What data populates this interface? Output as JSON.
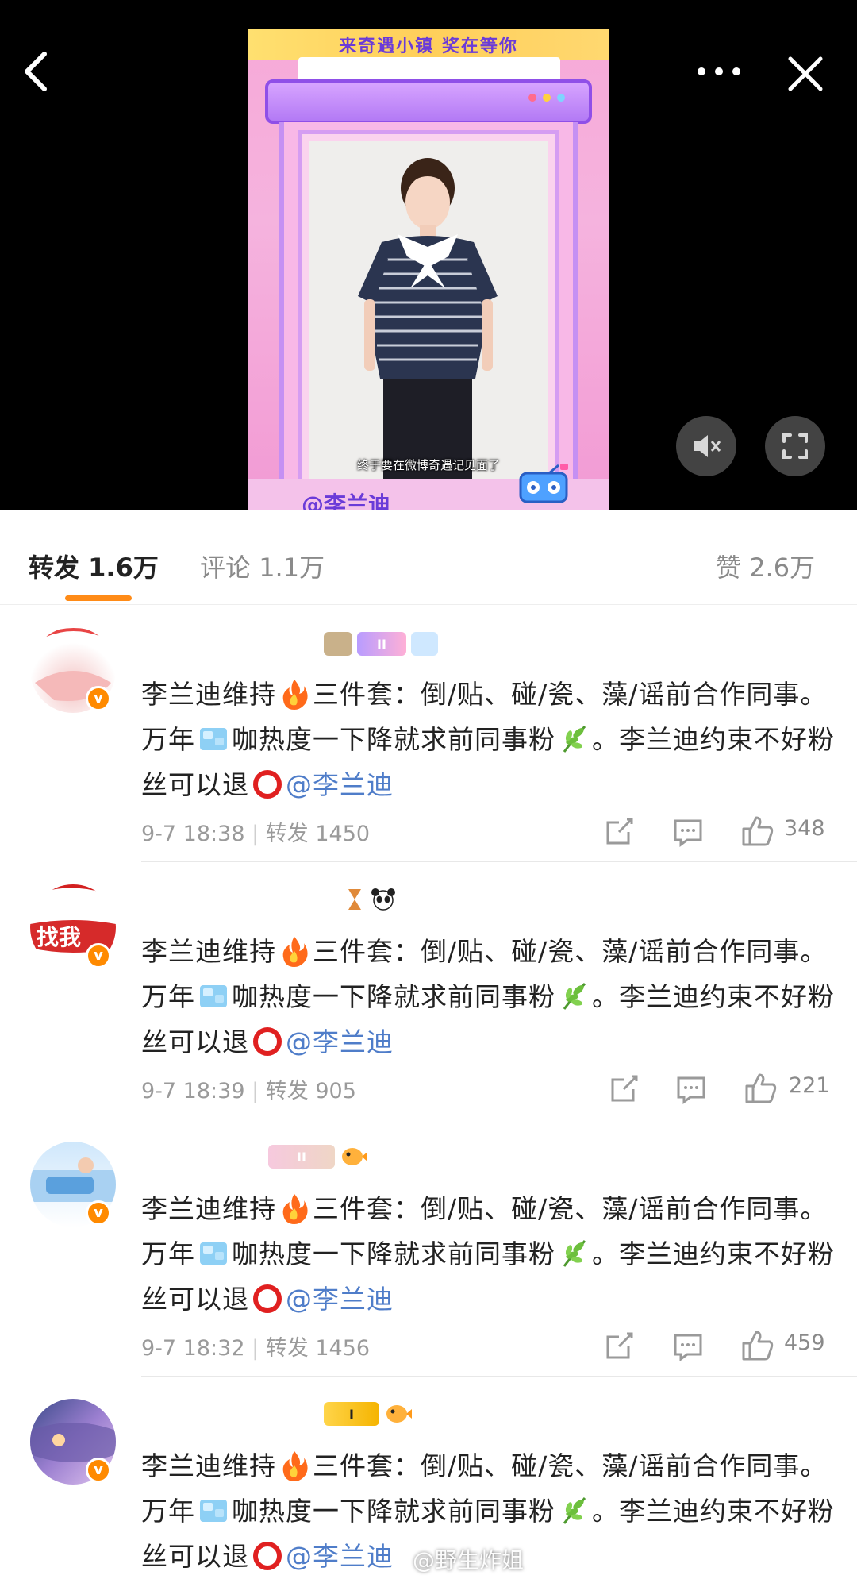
{
  "video": {
    "banner_text": "来奇遇小镇 奖在等你",
    "subtitle": "终于要在微博奇遇记见面了",
    "handle": "@李兰迪",
    "controls": [
      "mute-icon",
      "fullscreen-icon"
    ]
  },
  "nav": {
    "icons": [
      "back-arrow-icon",
      "more-icon",
      "close-icon"
    ]
  },
  "tabs": {
    "repost": {
      "label": "转发",
      "count": "1.6万"
    },
    "comment": {
      "label": "评论",
      "count": "1.1万"
    },
    "like": {
      "label": "赞",
      "count": "2.6万"
    }
  },
  "comments": [
    {
      "text_1": "李兰迪维持",
      "text_2": "三件套：倒/贴、碰/瓷、藻/谣前合作同事。万年",
      "text_3": "咖热度一下降就求前同事粉",
      "text_4": "。李兰迪约束不好粉丝可以退",
      "mention": "@李兰迪",
      "time": "9-7 18:38",
      "repost": "转发 1450",
      "likes": "348"
    },
    {
      "text_1": "李兰迪维持",
      "text_2": "三件套：倒/贴、碰/瓷、藻/谣前合作同事。万年",
      "text_3": "咖热度一下降就求前同事粉",
      "text_4": "。李兰迪约束不好粉丝可以退",
      "mention": "@李兰迪",
      "time": "9-7 18:39",
      "repost": "转发 905",
      "likes": "221"
    },
    {
      "text_1": "李兰迪维持",
      "text_2": "三件套：倒/贴、碰/瓷、藻/谣前合作同事。万年",
      "text_3": "咖热度一下降就求前同事粉",
      "text_4": "。李兰迪约束不好粉丝可以退",
      "mention": "@李兰迪",
      "time": "9-7 18:32",
      "repost": "转发 1456",
      "likes": "459"
    },
    {
      "text_1": "李兰迪维持",
      "text_2": "三件套：倒/贴、碰/瓷、藻/谣前合作同事。万年",
      "text_3": "咖热度一下降就求前同事粉",
      "text_4": "。李兰迪约束不好粉丝可以退",
      "mention": "@李兰迪"
    }
  ],
  "colors": {
    "accent": "#ff8b17",
    "mention": "#4f7dc9",
    "verified": "#ff8a00"
  },
  "watermark": "@野生炸姐"
}
